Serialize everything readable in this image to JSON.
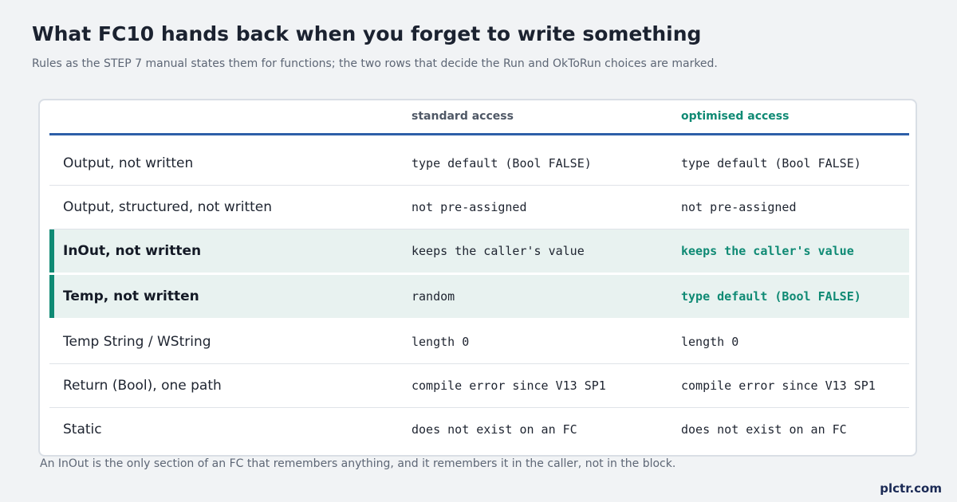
{
  "header": {
    "title": "What FC10 hands back when you forget to write something",
    "subtitle": "Rules as the STEP 7 manual states them for functions; the two rows that decide the Run and OkToRun choices are marked."
  },
  "table": {
    "columns": [
      "",
      "standard access",
      "optimised access"
    ],
    "rows": [
      {
        "label": "Output, not written",
        "standard": "type default (Bool FALSE)",
        "optimised": "type default (Bool FALSE)",
        "marked": false
      },
      {
        "label": "Output, structured, not written",
        "standard": "not pre-assigned",
        "optimised": "not pre-assigned",
        "marked": false
      },
      {
        "label": "InOut, not written",
        "standard": "keeps the caller's value",
        "optimised": "keeps the caller's value",
        "marked": true
      },
      {
        "label": "Temp, not written",
        "standard": "random",
        "optimised": "type default (Bool FALSE)",
        "marked": true
      },
      {
        "label": "Temp String / WString",
        "standard": "length 0",
        "optimised": "length 0",
        "marked": false
      },
      {
        "label": "Return (Bool), one path",
        "standard": "compile error since V13 SP1",
        "optimised": "compile error since V13 SP1",
        "marked": false
      },
      {
        "label": "Static",
        "standard": "does not exist on an FC",
        "optimised": "does not exist on an FC",
        "marked": false
      }
    ]
  },
  "footnote": "An InOut is the only section of an FC that remembers anything, and it remembers it in the caller, not in the block.",
  "brand": "plctr.com",
  "colors": {
    "accent": "#0f8a74",
    "header_rule": "#2d5fa8",
    "marked_row_bg": "#e8f2f0"
  }
}
